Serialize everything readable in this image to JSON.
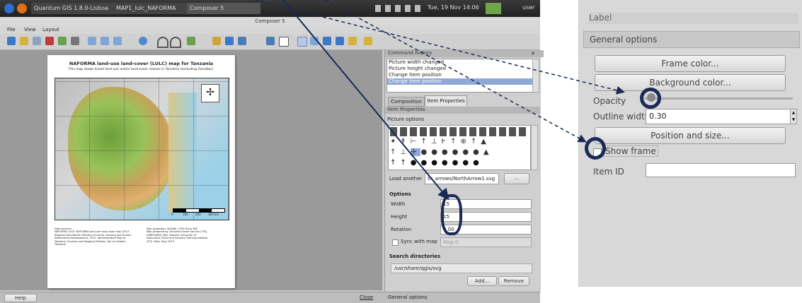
{
  "taskbar": {
    "items": [
      "Quantum GIS 1.8.0-Lisboa -...",
      "MAP1_lulc_NAFORMA",
      "Composer 5"
    ],
    "clock": "Tue, 19 Nov 14:06",
    "user": "user"
  },
  "window": {
    "title": "Composer 5"
  },
  "menu": [
    "File",
    "View",
    "Layout"
  ],
  "map": {
    "title": "NAFORMA land-use land-cover (LULC) map for Tanzania",
    "subtitle": "This map shows broad land-use and/or land-cover classes in Tanzania (excluding Zanzibar).",
    "scale_labels": [
      "0",
      "100",
      "200",
      "300 km"
    ],
    "footer_left": "Data sources:\nNAFORMA 2013. NAFORMA land-use land-cover map 2013.\nRegional boundaries: Ministry of Lands, Housing and Human\nSettlements Development. 2011. administrative Map of\nTanzania. Surveys and Mapping Division, Dar es Salaam\nTanzania.",
    "footer_right": "Map projection: WGS84 / UTM Zone 36S\nMap prepared by: Tanzania Forest Service (TFS),\nSAWFHAMA, MKI, Sokoine University of\nAgriculture (SUA) and Forestry Training Institute\n(FTI). Date: May 2013"
  },
  "command_history": {
    "title": "Command history",
    "items": [
      "Picture width changed",
      "Picture height changed",
      "Change item position",
      "Change item position"
    ]
  },
  "tabs": {
    "composition": "Composition",
    "item_properties": "Item Properties"
  },
  "item_properties": {
    "header": "Item Properties",
    "picture_options": "Picture options",
    "load_another_label": "Load another",
    "load_another_value": "th_arrows/NorthArrow1.svg",
    "browse_label": "...",
    "options_header": "Options",
    "width_label": "Width",
    "width_value": "15",
    "height_label": "Height",
    "height_value": "15",
    "rotation_label": "Rotation",
    "rotation_value": "0.00",
    "sync_label": "Sync with map",
    "sync_select": "Map 0",
    "search_dirs_header": "Search directories",
    "search_dir_value": "/usr/share/qgis/svg",
    "add_label": "Add...",
    "remove_label": "Remove"
  },
  "status": {
    "help": "Help",
    "close": "Close",
    "general_options": "General options"
  },
  "zoom": {
    "label_tab": "Label",
    "general_options": "General options",
    "frame_color": "Frame color...",
    "background_color": "Background color...",
    "opacity_label": "Opacity",
    "outline_width_label": "Outline width",
    "outline_width_value": "0.30",
    "position_size": "Position and size...",
    "show_frame": "Show frame",
    "item_id_label": "Item ID",
    "item_id_value": ""
  },
  "colors": {
    "annotation": "#1a2a55",
    "selection": "#8fa8d6"
  }
}
